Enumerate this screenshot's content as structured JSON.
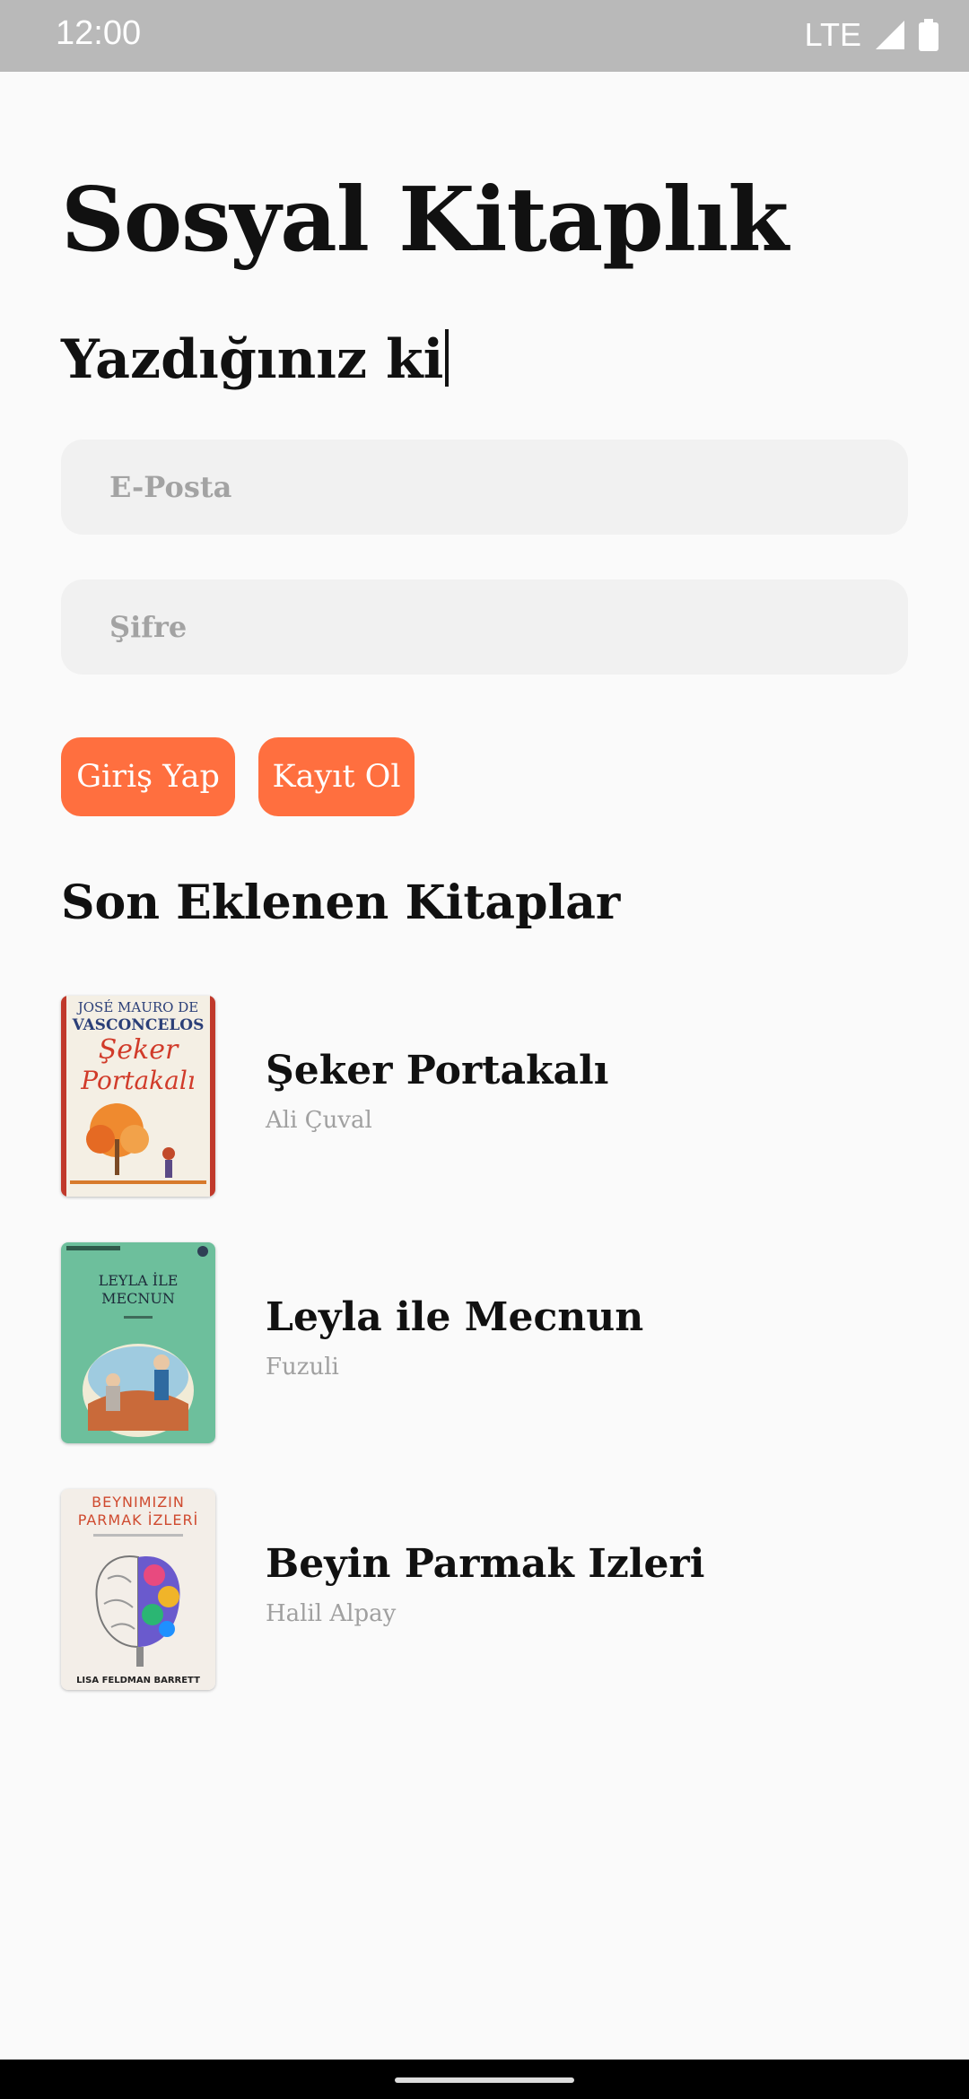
{
  "status_bar": {
    "time": "12:00",
    "network": "LTE",
    "icons": [
      "signal-icon",
      "battery-icon"
    ]
  },
  "app": {
    "title": "Sosyal Kitaplık",
    "typing_text": "Yazdığınız ki"
  },
  "form": {
    "email": {
      "placeholder": "E-Posta",
      "value": ""
    },
    "password": {
      "placeholder": "Şifre",
      "value": ""
    },
    "login_label": "Giriş Yap",
    "register_label": "Kayıt Ol"
  },
  "recent": {
    "title": "Son Eklenen Kitaplar",
    "books": [
      {
        "title": "Şeker Portakalı",
        "author": "Ali Çuval",
        "cover": {
          "line1": "JOSÉ MAURO DE",
          "line2": "VASCONCELOS",
          "line3": "Şeker",
          "line4": "Portakalı"
        }
      },
      {
        "title": "Leyla ile Mecnun",
        "author": "Fuzuli",
        "cover": {
          "line1": "LEYLA İLE",
          "line2": "MECNUN"
        }
      },
      {
        "title": "Beyin Parmak Izleri",
        "author": "Halil Alpay",
        "cover": {
          "line1": "BEYNIMIZIN",
          "line2": "PARMAK İZLERİ",
          "line3": "LISA FELDMAN BARRETT"
        }
      }
    ]
  },
  "colors": {
    "accent": "#ff6f3f",
    "background": "#fafafa",
    "field": "#f1f1f1",
    "status_bar": "#b9b9b9"
  }
}
